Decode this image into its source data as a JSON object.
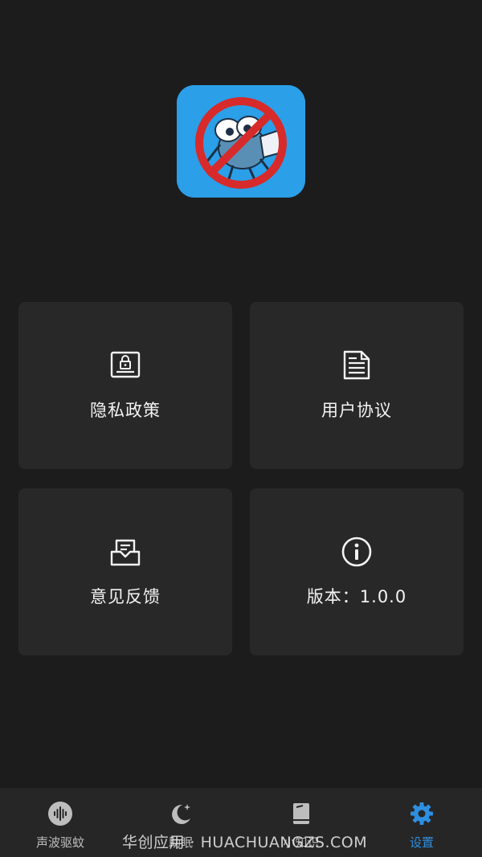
{
  "app": {
    "icon_name": "no-mosquito-icon",
    "brand_color": "#2b9fe8"
  },
  "cards": [
    {
      "label": "隐私政策",
      "icon": "lock-document-icon"
    },
    {
      "label": "用户协议",
      "icon": "document-icon"
    },
    {
      "label": "意见反馈",
      "icon": "mail-tray-icon"
    },
    {
      "label": "版本：1.0.0",
      "icon": "info-icon"
    }
  ],
  "tabbar": {
    "items": [
      {
        "label": "声波驱蚊",
        "icon": "sound-wave-icon",
        "active": false
      },
      {
        "label": "助眠",
        "icon": "moon-icon",
        "active": false
      },
      {
        "label": "小知识",
        "icon": "book-icon",
        "active": false
      },
      {
        "label": "设置",
        "icon": "gear-icon",
        "active": true
      }
    ],
    "active_color": "#2e8fe0",
    "inactive_color": "#bdbdbd"
  },
  "watermark": "华创应用 · HUACHUANGZS.COM"
}
